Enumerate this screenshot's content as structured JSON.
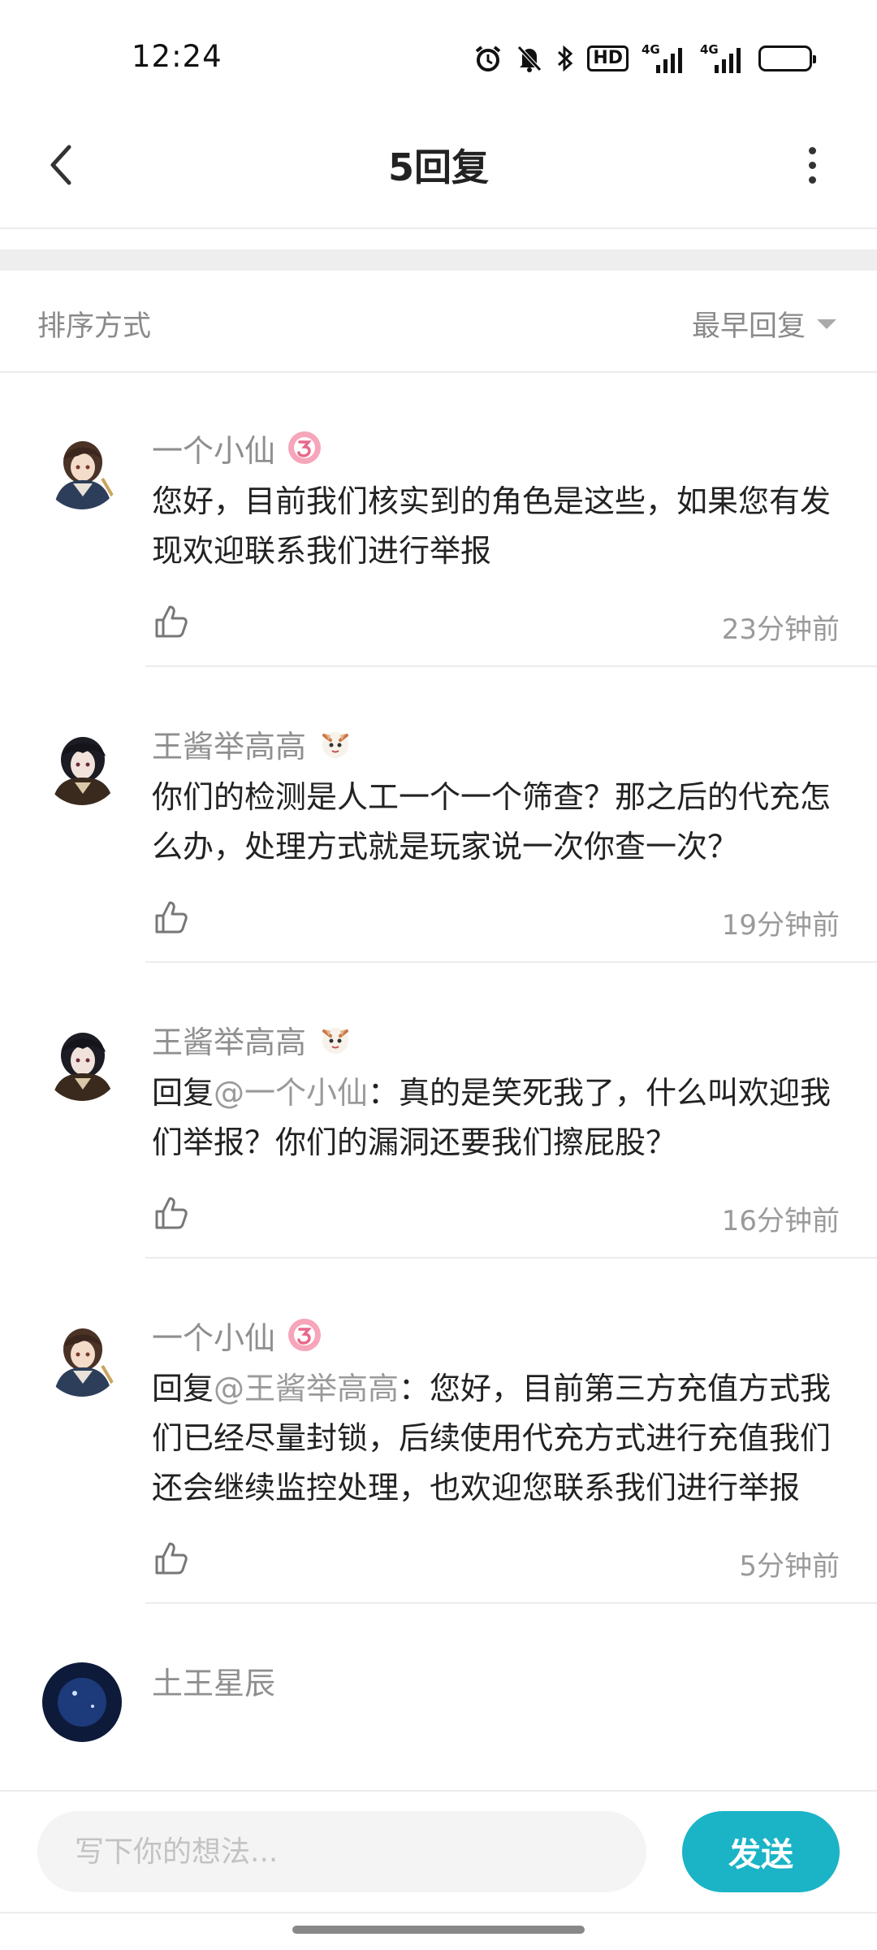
{
  "status_bar": {
    "time": "12:24",
    "hd_label": "HD",
    "network_1": "4G",
    "network_2": "4G",
    "icons": [
      "alarm-icon",
      "mute-bell-icon",
      "bluetooth-icon",
      "hd-icon",
      "signal-icon",
      "signal-icon",
      "battery-icon"
    ]
  },
  "header": {
    "title": "5回复",
    "back_icon": "chevron-left-icon",
    "more_icon": "more-vertical-icon"
  },
  "sort": {
    "label": "排序方式",
    "selected": "最早回复"
  },
  "comments": [
    {
      "user": "一个小仙",
      "badge": "official-badge-icon",
      "prefix": "",
      "mention": "",
      "text": "您好，目前我们核实到的角色是这些，如果您有发现欢迎联系我们进行举报",
      "time": "23分钟前"
    },
    {
      "user": "王酱举高高",
      "badge": "character-badge-icon",
      "prefix": "",
      "mention": "",
      "text": "你们的检测是人工一个一个筛查？那之后的代充怎么办，处理方式就是玩家说一次你查一次？",
      "time": "19分钟前"
    },
    {
      "user": "王酱举高高",
      "badge": "character-badge-icon",
      "prefix": "回复",
      "mention": "@一个小仙",
      "text": "：真的是笑死我了，什么叫欢迎我们举报？你们的漏洞还要我们擦屁股？",
      "time": "16分钟前"
    },
    {
      "user": "一个小仙",
      "badge": "official-badge-icon",
      "prefix": "回复",
      "mention": "@王酱举高高",
      "text": "：您好，目前第三方充值方式我们已经尽量封锁，后续使用代充方式进行充值我们还会继续监控处理，也欢迎您联系我们进行举报",
      "time": "5分钟前"
    },
    {
      "user": "土王星辰",
      "badge": "",
      "prefix": "",
      "mention": "",
      "text": "",
      "time": ""
    }
  ],
  "composer": {
    "placeholder": "写下你的想法...",
    "value": "",
    "send_label": "发送"
  },
  "colors": {
    "accent": "#1ab4c6",
    "official_badge": "#f08aa5",
    "muted_text": "#8f8f8f"
  }
}
